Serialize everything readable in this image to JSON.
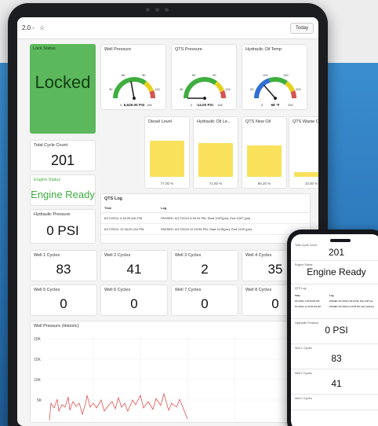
{
  "browser": {
    "version": "2.0 -",
    "star": "☆"
  },
  "toolbar": {
    "today_label": "Today"
  },
  "lock": {
    "title": "Lock Status",
    "value": "Locked"
  },
  "gauges": [
    {
      "title": "Well Pressure",
      "tick_low": "0",
      "tick_3": "3K",
      "tick_6": "6K",
      "tick_9": "9K",
      "tick_12": "12K",
      "tick_15": "15K",
      "readout": "6,629.00 PSI",
      "value": 6629,
      "max": 15000
    },
    {
      "title": "QTS Pressure",
      "tick_low": "0",
      "tick_3": "3K",
      "tick_6": "6K",
      "tick_9": "9K",
      "tick_12": "12K",
      "tick_15": "15K",
      "readout": "-14.00 PSI",
      "value": -14,
      "max": 15000
    },
    {
      "title": "Hydraulic Oil Temp",
      "tick_low": "0",
      "tick_3": "50",
      "tick_6": "100",
      "tick_9": "150",
      "tick_12": "200",
      "tick_15": "250",
      "readout": "68 °F",
      "value": 68,
      "max": 250
    }
  ],
  "tanks": [
    {
      "title": "Diesel Level",
      "pct": "77.00 %",
      "fill": 0.77
    },
    {
      "title": "Hydraulic Oil Le...",
      "pct": "71.60 %",
      "fill": 0.716
    },
    {
      "title": "QTS New Oil",
      "pct": "66.20 %",
      "fill": 0.662
    },
    {
      "title": "QTS Waste Oil",
      "pct": "10.00 %",
      "fill": 0.1
    }
  ],
  "cycle_count": {
    "title": "Total Cycle Count",
    "value": "201"
  },
  "engine": {
    "title": "Engine Status",
    "value": "Engine Ready"
  },
  "hyd_pressure": {
    "title": "Hydraulic Pressure",
    "value": "0 PSI"
  },
  "qts_log": {
    "title": "QTS Log",
    "col_time": "Time",
    "col_log": "Log",
    "rows": [
      {
        "time": "6/17/2024, 4:30:25.641 PM",
        "log": "PASSED: 6/17/2024 4:30:24 PM, Start 1097(psi), End 1097 (psi)"
      },
      {
        "time": "6/17/2024, 12:16:00.104 PM",
        "log": "PASSED: 6/17/2024 12:15:55 PM, Start 1149(psi), End 1149 (psi)"
      }
    ]
  },
  "wells": [
    {
      "title": "Well 1 Cycles",
      "value": "83"
    },
    {
      "title": "Well 2 Cycles",
      "value": "41"
    },
    {
      "title": "Well 3 Cycles",
      "value": "2"
    },
    {
      "title": "Well 4 Cycles",
      "value": "35"
    },
    {
      "title": "Well 5 Cycles",
      "value": "0"
    },
    {
      "title": "Well 6 Cycles",
      "value": "0"
    },
    {
      "title": "Well 7 Cycles",
      "value": "0"
    },
    {
      "title": "Well 8 Cycles",
      "value": "0"
    }
  ],
  "history": {
    "title": "Well Pressure (Historic)",
    "y_ticks": [
      "20K",
      "15K",
      "10K",
      "5K"
    ]
  },
  "phone": {
    "cycle_title": "Total Cycle Count",
    "cycle_value": "201",
    "engine_title": "Engine Status",
    "engine_value": "Engine Ready",
    "log_title": "QTS Log",
    "log_col_time": "Time",
    "log_col_log": "Log",
    "log_rows": [
      {
        "time": "6/17/2024, 4:30:25.641 PM",
        "log": "PASSED: 6/17/2024 4:30:24 PM, Start 1097 (psi"
      },
      {
        "time": "6/17/2024, 12:16:00.104 PM",
        "log": "PASSED: 6/17/2024 12:15:55 PM, Start 1149 (psi"
      }
    ],
    "hyd_title": "Hydraulic Pressure",
    "hyd_value": "0 PSI",
    "w1_title": "Well 1 Cycles",
    "w1_value": "83",
    "w2_title": "Well 2 Cycles",
    "w2_value": "41",
    "w3_title": "Well 3 Cycles"
  }
}
